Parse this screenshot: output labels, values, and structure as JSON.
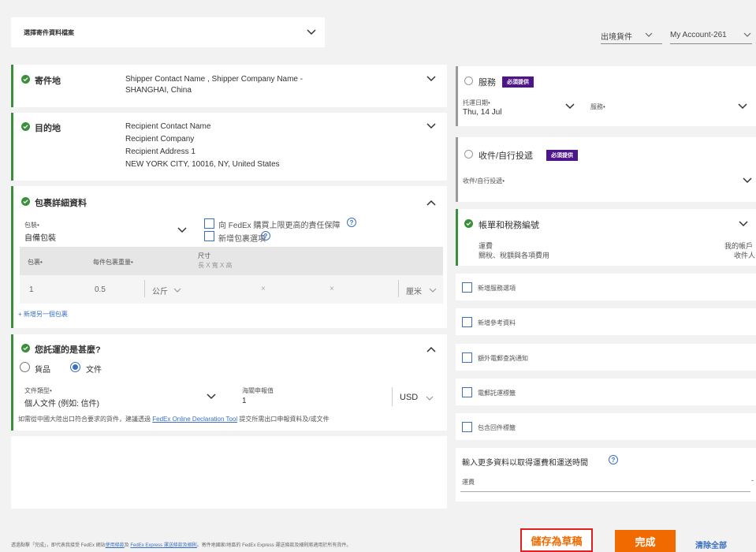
{
  "top": {
    "profile_select": "選擇寄件資料檔案",
    "outbound_label": "出境貨件",
    "account_label": "My Account-261"
  },
  "origin": {
    "title": "寄件地",
    "line1": "Shipper Contact Name , Shipper Company Name -",
    "line2": "SHANGHAI, China"
  },
  "destination": {
    "title": "目的地",
    "line1": "Recipient Contact Name",
    "line2": "Recipient Company",
    "line3": "Recipient Address 1",
    "line4": "NEW YORK CITY, 10016, NY, United States"
  },
  "package": {
    "title": "包裹詳細資料",
    "packaging_label": "包裝•",
    "packaging_value": "自備包裝",
    "liability_text": "向 FedEx 購買上限更高的責任保障",
    "add_option_text": "新增包裹選項",
    "col_count": "包裹•",
    "col_weight": "每件包裹重量•",
    "col_dims": "尺寸",
    "dims_placeholder": "長 X 寬 X 高",
    "row_count": "1",
    "row_weight": "0.5",
    "weight_unit": "公斤",
    "dim_x": "×",
    "dim_x2": "×",
    "dim_unit": "厘米",
    "add_another": "+ 新增另一個包裹"
  },
  "contents": {
    "title": "您託運的是甚麼?",
    "option_goods": "貨品",
    "option_docs": "文件",
    "doc_type_label": "文件類型•",
    "doc_type_value": "個人文件 (例如: 信件)",
    "customs_label": "海關申報值",
    "customs_value": "1",
    "currency": "USD",
    "note_pre": "如需從中國大陸出口符合要求的貨件，建議透過 ",
    "note_link": "FedEx Online Declaration Tool",
    "note_post": " 提交所需出口申報資料及/或文件"
  },
  "service": {
    "title": "服務",
    "badge": "必須提供",
    "date_label": "托運日期•",
    "date_value": "Thu, 14 Jul",
    "service_label": "服務•"
  },
  "pickup": {
    "title": "收件/自行投遞",
    "badge": "必須提供",
    "field_label": "收件/自行投遞•"
  },
  "billing": {
    "title": "帳單和稅務編號",
    "line1": "運費",
    "line2": "關稅、稅額與各項費用",
    "right1": "我的帳戶",
    "right2": "收件人"
  },
  "options": [
    "新增服務選項",
    "新增參考資料",
    "額外電郵查詢通知",
    "電郵託運標籤",
    "包含回件標籤"
  ],
  "estimate": {
    "title": "輸入更多資料以取得運費和運送時間",
    "field": "運費"
  },
  "footer": {
    "note_pre": "透過點擊「完成」，即代表我接受 FedEx 網站",
    "note_link1": "使用條款",
    "note_mid": "及 ",
    "note_link2": "FedEx Express 運送條款及細則",
    "note_post": "。寄件地國家/地區的 FedEx Express 運送條款及細則將適用於所有貨件。",
    "save_draft": "儲存為草稿",
    "done": "完成",
    "clear_all": "清除全部"
  },
  "colors": {
    "accent_green": "#3b8f3b",
    "fedex_purple": "#4d148c",
    "fedex_orange": "#f06a00",
    "link_blue": "#3a6fc4",
    "highlight_red": "#e02020"
  }
}
